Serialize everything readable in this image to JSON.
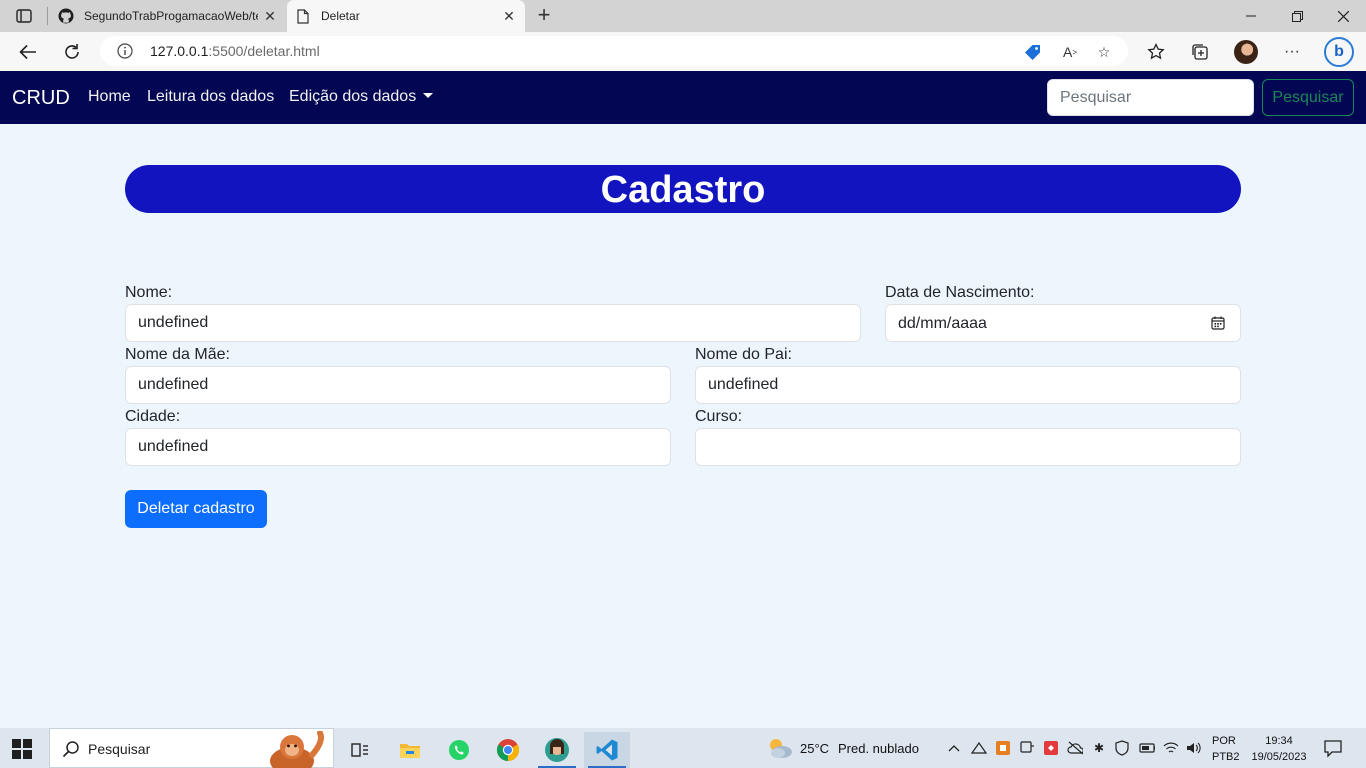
{
  "browser": {
    "tabs": [
      {
        "title": "SegundoTrabProgamacaoWeb/te",
        "icon": "github-icon",
        "active": false
      },
      {
        "title": "Deletar",
        "icon": "page-icon",
        "active": true
      }
    ],
    "address": {
      "host": "127.0.0.1",
      "path": ":5500/deletar.html"
    }
  },
  "navbar": {
    "brand": "CRUD",
    "links": [
      "Home",
      "Leitura dos dados",
      "Edição dos dados"
    ],
    "search_placeholder": "Pesquisar",
    "search_button": "Pesquisar"
  },
  "form": {
    "title": "Cadastro",
    "nome_label": "Nome:",
    "nome_value": "undefined",
    "data_label": "Data de Nascimento:",
    "data_placeholder": "dd/mm/aaaa",
    "mae_label": "Nome da Mãe:",
    "mae_value": "undefined",
    "pai_label": "Nome do Pai:",
    "pai_value": "undefined",
    "cidade_label": "Cidade:",
    "cidade_value": "undefined",
    "curso_label": "Curso:",
    "curso_value": "",
    "delete_button": "Deletar cadastro"
  },
  "taskbar": {
    "search_text": "Pesquisar",
    "weather_temp": "25°C",
    "weather_desc": "Pred. nublado",
    "lang_line1": "POR",
    "lang_line2": "PTB2",
    "time": "19:34",
    "date": "19/05/2023"
  },
  "colors": {
    "navbar_bg": "#030653",
    "heading_bg": "#1215bf",
    "primary_button": "#0d6efd",
    "success_outline": "#198754",
    "page_bg": "#eef6fd"
  }
}
